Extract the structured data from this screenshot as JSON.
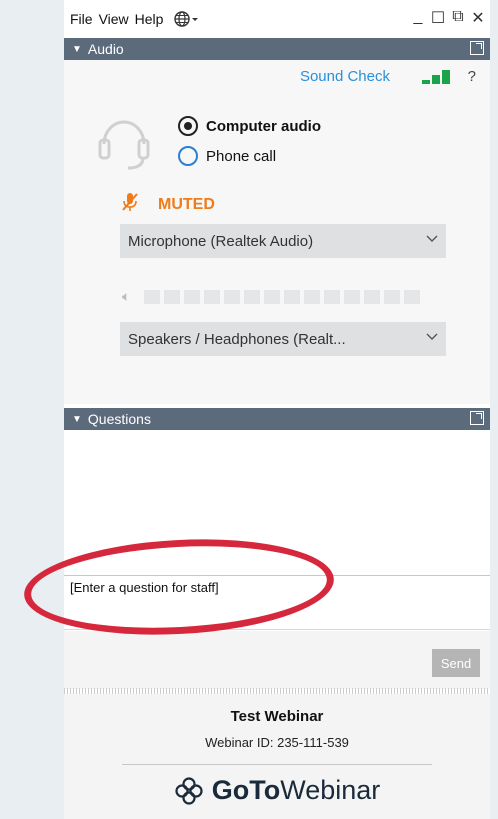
{
  "menu": {
    "file": "File",
    "view": "View",
    "help": "Help"
  },
  "audio": {
    "title": "Audio",
    "sound_check": "Sound Check",
    "help_symbol": "?",
    "computer_audio": "Computer audio",
    "phone_call": "Phone call",
    "muted_label": "MUTED",
    "microphone": "Microphone (Realtek Audio)",
    "speakers": "Speakers / Headphones (Realt..."
  },
  "questions": {
    "title": "Questions",
    "input_text": "[Enter a question for staff]",
    "send_label": "Send"
  },
  "footer": {
    "webinar_title": "Test Webinar",
    "webinar_id": "Webinar ID: 235-111-539",
    "logo_bold": "GoTo",
    "logo_regular": "Webinar"
  },
  "colors": {
    "accent_blue": "#2a8fd8",
    "muted_orange": "#f07b1a",
    "signal_green": "#1aa34a",
    "annotation_red": "#d6283d"
  },
  "icons": [
    "globe-icon",
    "headset-icon",
    "microphone-muted-icon",
    "speaker-icon",
    "chevron-down-icon",
    "popout-icon",
    "gotowebinar-logo-icon"
  ]
}
